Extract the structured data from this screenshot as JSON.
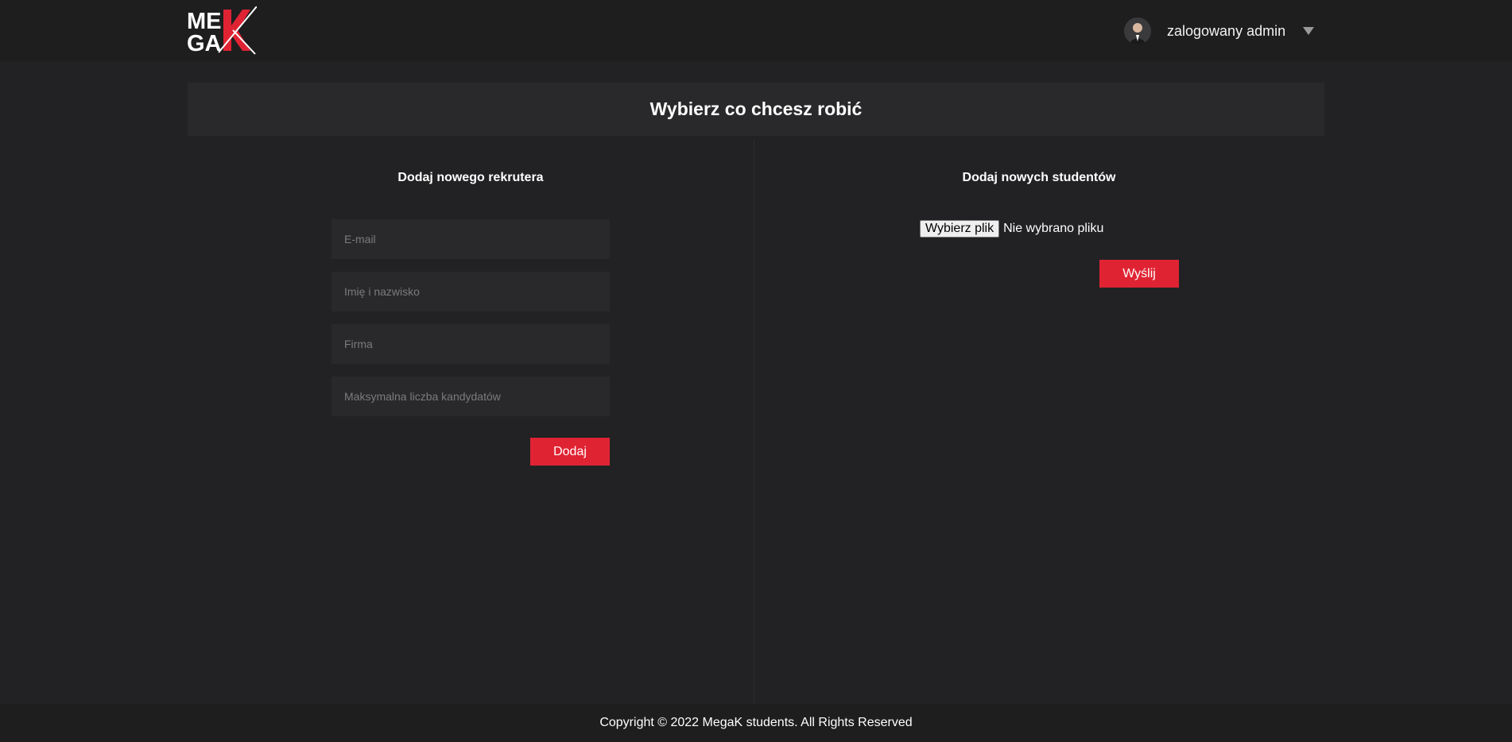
{
  "header": {
    "logo_text": "MEGAK",
    "user_label": "zalogowany admin",
    "avatar": "user-avatar-photo",
    "menu_icon": "chevron-down-icon"
  },
  "main": {
    "title": "Wybierz co chcesz robić",
    "recruiter_form": {
      "title": "Dodaj nowego rekrutera",
      "email_placeholder": "E-mail",
      "name_placeholder": "Imię i nazwisko",
      "company_placeholder": "Firma",
      "max_candidates_placeholder": "Maksymalna liczba kandydatów",
      "submit_label": "Dodaj"
    },
    "students_form": {
      "title": "Dodaj nowych studentów",
      "file_button_label": "Wybierz plik",
      "file_status": "Nie wybrano pliku",
      "submit_label": "Wyślij"
    }
  },
  "footer": {
    "text": "Copyright © 2022 MegaK students. All Rights Reserved"
  },
  "colors": {
    "background": "#222224",
    "header_bg": "#1e1e1f",
    "panel_bg": "#29292b",
    "accent_red": "#e02333"
  }
}
